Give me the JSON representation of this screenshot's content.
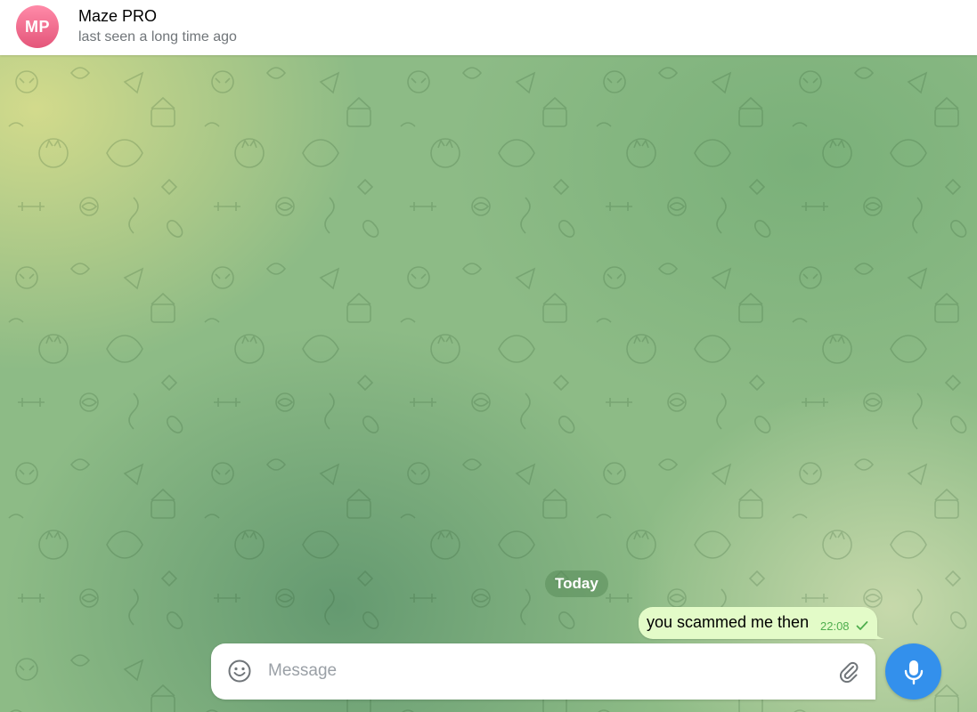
{
  "header": {
    "avatar_initials": "MP",
    "title": "Maze PRO",
    "status": "last seen a long time ago"
  },
  "chat": {
    "date_separator": "Today",
    "messages": [
      {
        "text": "you scammed me then",
        "time": "22:08",
        "status_icon": "single-check-icon",
        "outgoing": true
      }
    ]
  },
  "composer": {
    "placeholder": "Message",
    "value": "",
    "emoji_icon": "smile-icon",
    "attach_icon": "paperclip-icon",
    "send_icon": "microphone-icon"
  },
  "colors": {
    "accent": "#3390ec",
    "outgoing_bubble": "#e3fbc8",
    "time_green": "#4fae4e",
    "avatar_gradient_top": "#ff8aa8",
    "avatar_gradient_bottom": "#e4567a"
  }
}
